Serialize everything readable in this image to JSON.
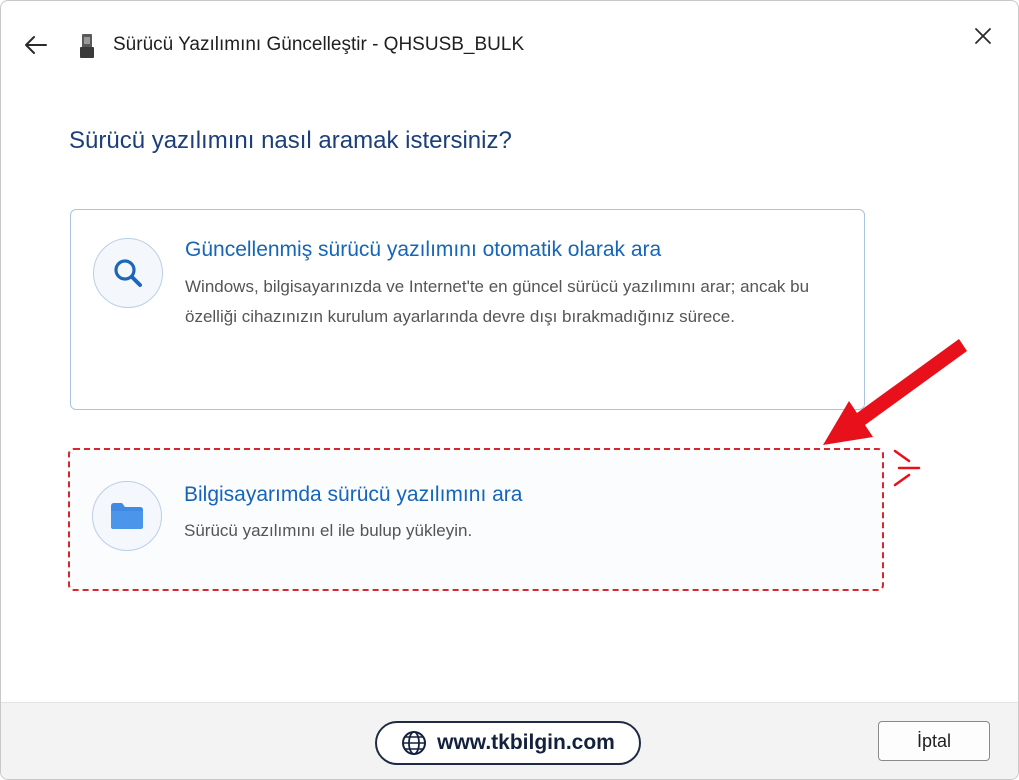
{
  "window": {
    "title": "Sürücü Yazılımını Güncelleştir - QHSUSB_BULK"
  },
  "question": "Sürücü yazılımını nasıl aramak istersiniz?",
  "options": [
    {
      "title": "Güncellenmiş sürücü yazılımını otomatik olarak ara",
      "description": "Windows, bilgisayarınızda ve Internet'te en güncel sürücü yazılımını arar; ancak bu özelliği cihazınızın kurulum ayarlarında devre dışı bırakmadığınız sürece.",
      "icon": "search-icon"
    },
    {
      "title": "Bilgisayarımda sürücü yazılımını ara",
      "description": "Sürücü yazılımını el ile bulup yükleyin.",
      "icon": "folder-icon"
    }
  ],
  "footer": {
    "watermark": "www.tkbilgin.com",
    "cancel_label": "İptal"
  },
  "colors": {
    "accent": "#1565b8",
    "heading": "#1c3f7a",
    "highlight": "#d9272e"
  }
}
